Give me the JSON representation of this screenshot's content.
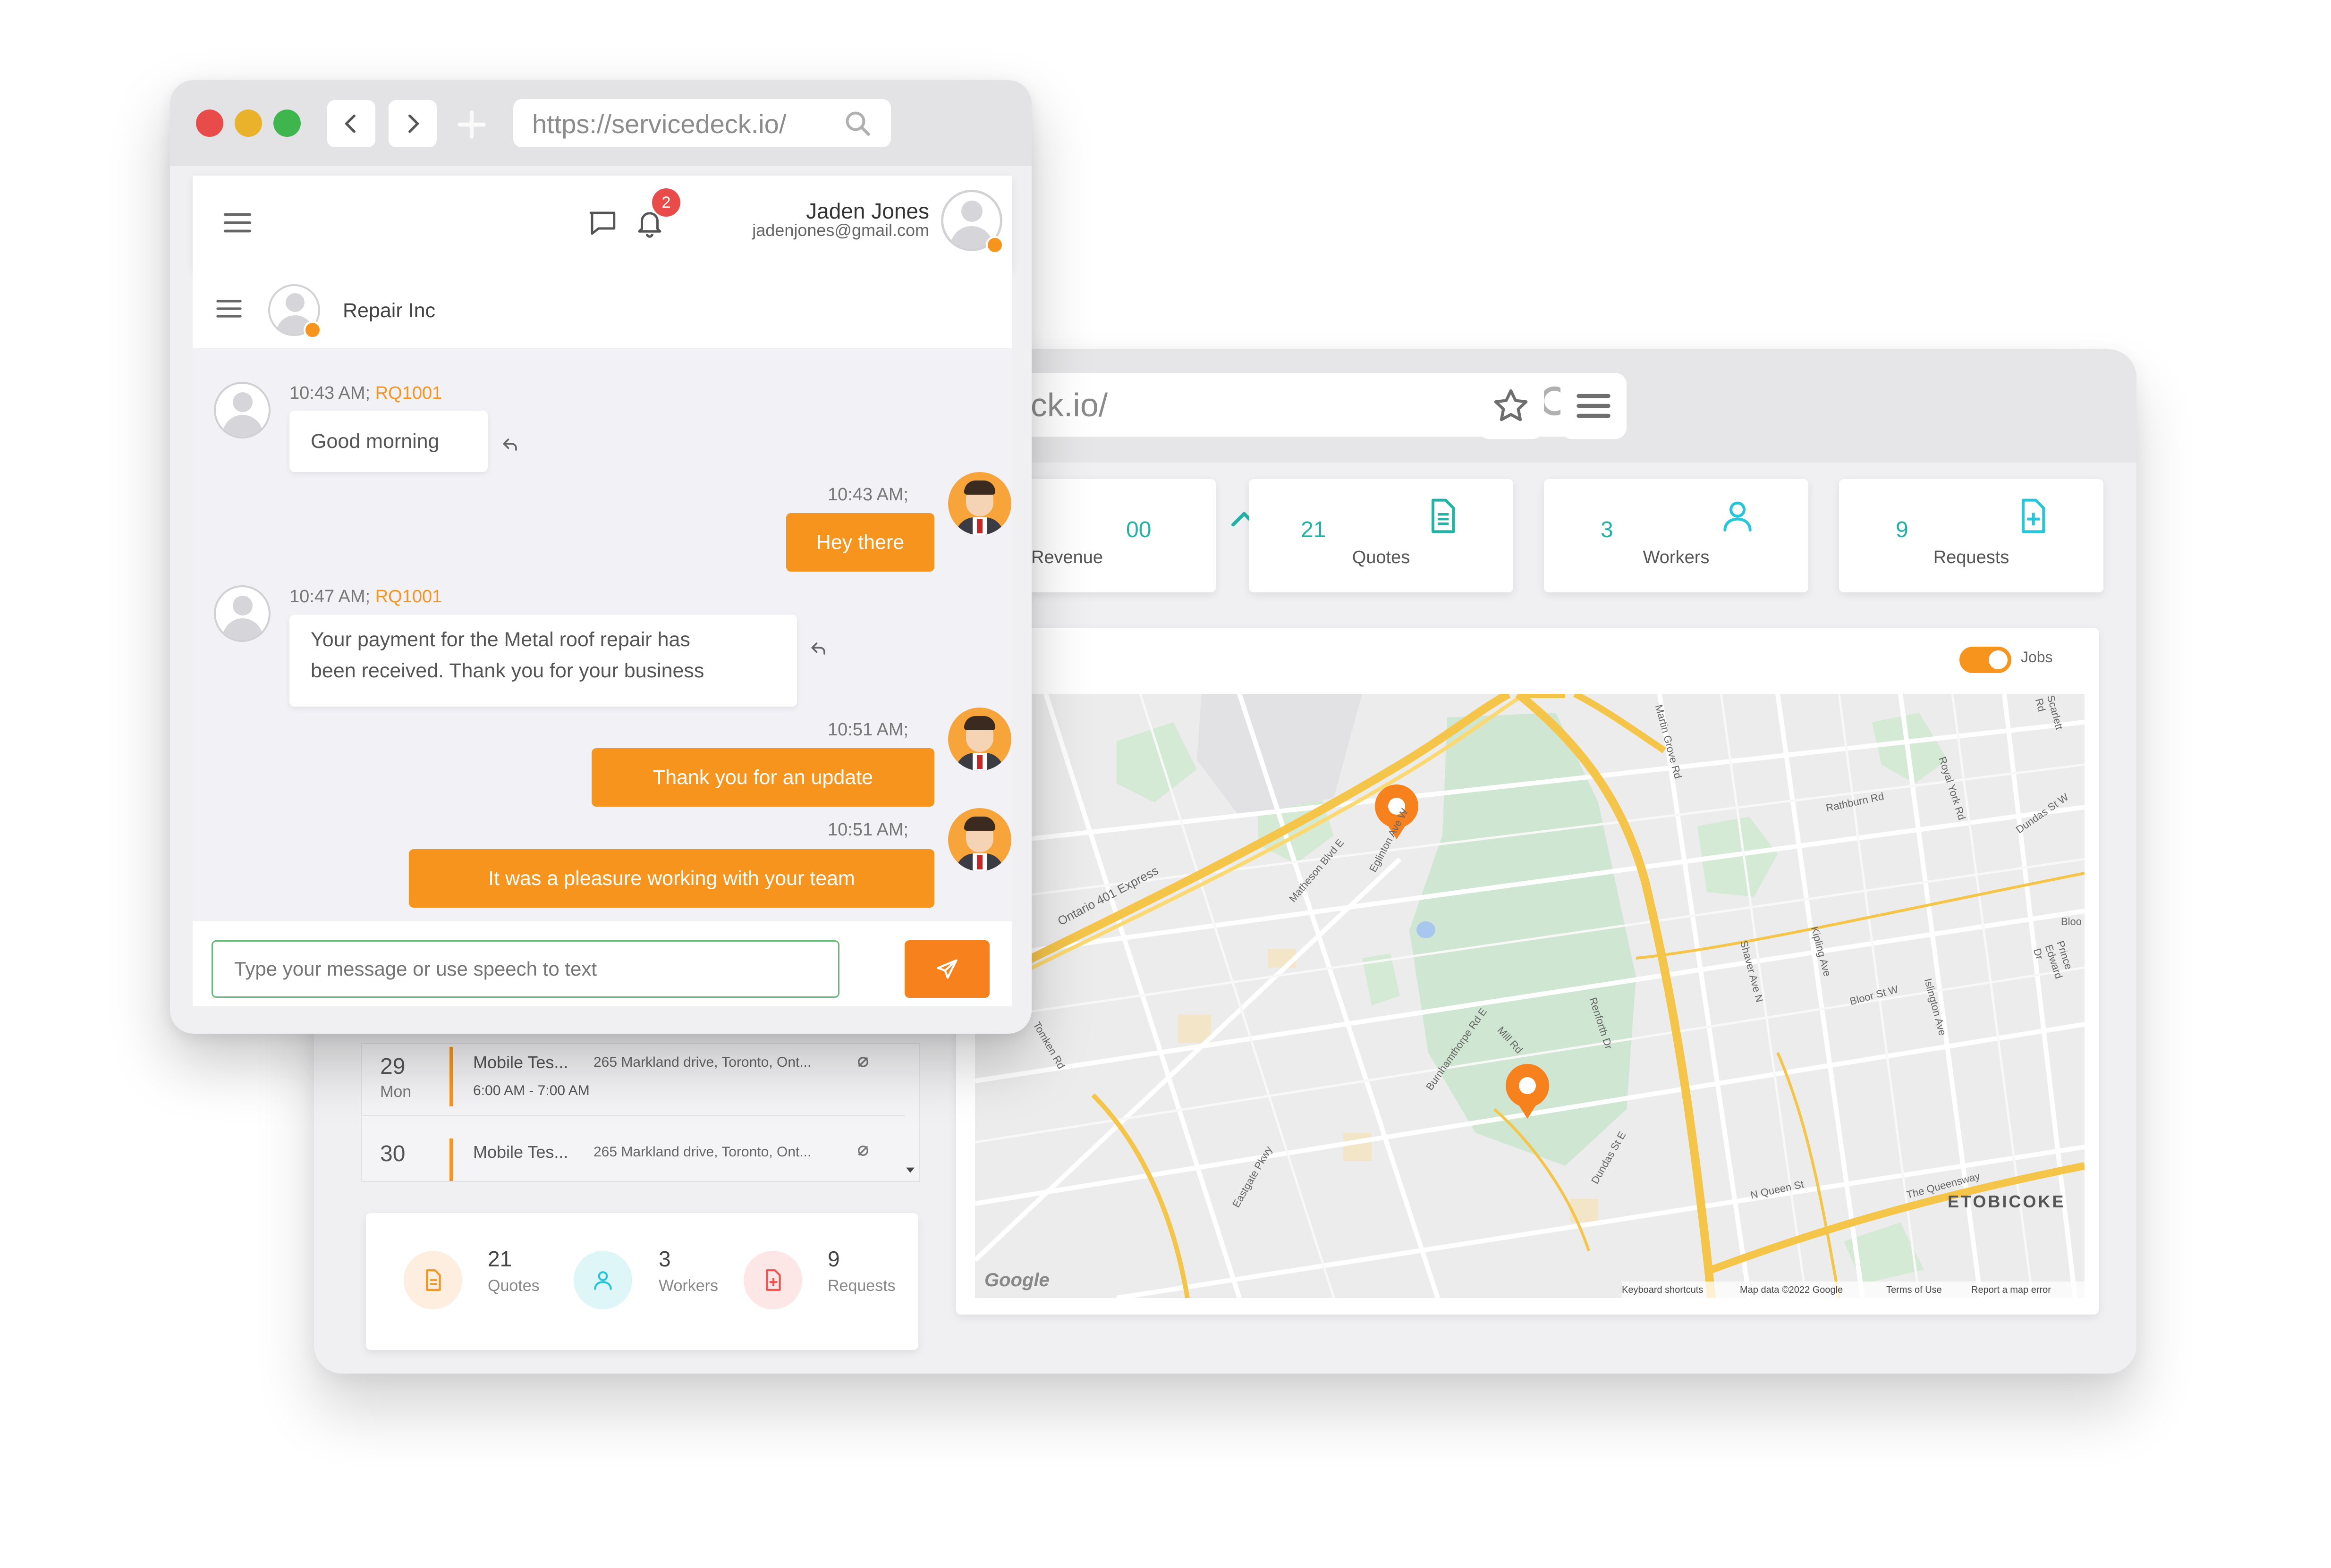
{
  "back_window": {
    "url": "https://servicedeck.io/",
    "url_visible": "deck.io/",
    "stats": [
      {
        "value": "00",
        "label": "Revenue",
        "icon": "trending-up-icon"
      },
      {
        "value": "21",
        "label": "Quotes",
        "icon": "document-icon"
      },
      {
        "value": "3",
        "label": "Workers",
        "icon": "user-icon"
      },
      {
        "value": "9",
        "label": "Requests",
        "icon": "file-plus-icon"
      }
    ],
    "map": {
      "toggle_label": "Jobs",
      "toggle_on": true,
      "labels": {
        "etobicoke": "ETOBICOKE",
        "ontario401": "Ontario 401 Express",
        "eglinton": "Eglinton Ave W",
        "matheson": "Matheson Blvd E",
        "martin_grove": "Martin Grove Rd",
        "rathburn": "Rathburn Rd",
        "royal_york": "Royal York Rd",
        "dundas_w": "Dundas St W",
        "kipling": "Kipling Ave",
        "bloor": "Bloor St W",
        "queen": "N Queen St",
        "queensway": "The Queensway",
        "burnhamthorpe": "Burnhamthorpe Rd E",
        "eastgate": "Eastgate Pkwy",
        "tomken": "Tomken Rd",
        "islington": "Islington Ave",
        "shaver": "Shaver Ave N",
        "renforth": "Renforth Dr",
        "mill": "Mill Rd",
        "prince_edward": "Prince Edward Dr",
        "dundas_e": "Dundas St E",
        "google": "Google",
        "keyboard": "Keyboard shortcuts",
        "mapdata": "Map data ©2022 Google",
        "terms": "Terms of Use",
        "report": "Report a map error",
        "scarlett": "Scarlett Rd",
        "bloo": "Bloo"
      }
    },
    "schedule": [
      {
        "day": "29",
        "dow": "Mon",
        "title": "Mobile Tes...",
        "address": "265 Markland drive, Toronto, Ont...",
        "time": "6:00 AM - 7:00 AM"
      },
      {
        "day": "30",
        "dow": "",
        "title": "Mobile Tes...",
        "address": "265 Markland drive, Toronto, Ont...",
        "time": ""
      }
    ],
    "bottom_stats": [
      {
        "value": "21",
        "label": "Quotes",
        "color": "#f7941d"
      },
      {
        "value": "3",
        "label": "Workers",
        "color": "#26c6da"
      },
      {
        "value": "9",
        "label": "Requests",
        "color": "#ef5350"
      }
    ]
  },
  "front_window": {
    "url": "https://servicedeck.io/",
    "header": {
      "user_name": "Jaden Jones",
      "user_email": "jadenjones@gmail.com",
      "notification_count": "2"
    },
    "chat": {
      "contact_name": "Repair Inc",
      "messages": [
        {
          "direction": "in",
          "time": "10:43 AM;",
          "tag": "RQ1001",
          "text": "Good morning"
        },
        {
          "direction": "out",
          "time": "10:43 AM;",
          "text": "Hey there"
        },
        {
          "direction": "in",
          "time": "10:47 AM;",
          "tag": "RQ1001",
          "line1": "Your payment for the Metal roof repair has",
          "line2": "been received. Thank you for your business"
        },
        {
          "direction": "out",
          "time": "10:51 AM;",
          "text": "Thank you for an update"
        },
        {
          "direction": "out",
          "time": "10:51 AM;",
          "text": "It was a pleasure working with your team"
        }
      ],
      "input_placeholder": "Type your message or use speech to text"
    }
  },
  "colors": {
    "accent": "#f7941d",
    "teal": "#21b3a6",
    "close": "#e94b4b",
    "minimize": "#e9b22a",
    "maximize": "#3fb54e"
  }
}
